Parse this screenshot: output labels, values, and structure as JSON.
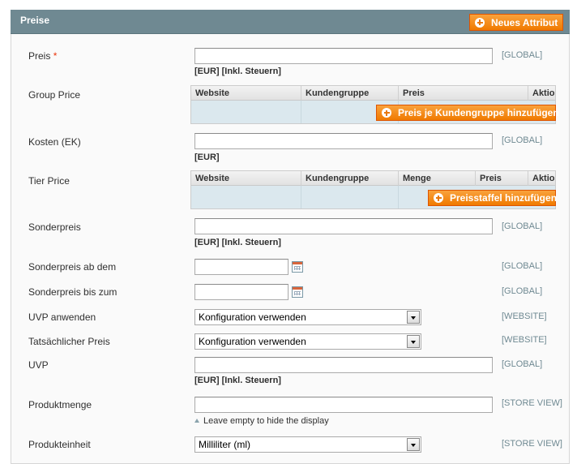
{
  "section": {
    "title": "Preise",
    "add_attribute": "Neues Attribut"
  },
  "fields": {
    "preis": {
      "label": "Preis",
      "required_mark": "*",
      "note": "[EUR] [Inkl. Steuern]",
      "scope": "[GLOBAL]",
      "value": ""
    },
    "group_price": {
      "label": "Group Price",
      "columns": [
        "Website",
        "Kundengruppe",
        "Preis",
        "Aktio"
      ],
      "add_button": "Preis je Kundengruppe hinzufügen"
    },
    "kosten": {
      "label": "Kosten (EK)",
      "note": "[EUR]",
      "scope": "[GLOBAL]",
      "value": ""
    },
    "tier_price": {
      "label": "Tier Price",
      "columns": [
        "Website",
        "Kundengruppe",
        "Menge",
        "Preis",
        "Aktio"
      ],
      "add_button": "Preisstaffel hinzufügen"
    },
    "sonderpreis": {
      "label": "Sonderpreis",
      "note": "[EUR] [Inkl. Steuern]",
      "scope": "[GLOBAL]",
      "value": ""
    },
    "sonderpreis_ab": {
      "label": "Sonderpreis ab dem",
      "scope": "[GLOBAL]",
      "value": ""
    },
    "sonderpreis_bis": {
      "label": "Sonderpreis bis zum",
      "scope": "[GLOBAL]",
      "value": ""
    },
    "uvp_anwenden": {
      "label": "UVP anwenden",
      "selected": "Konfiguration verwenden",
      "scope": "[WEBSITE]"
    },
    "tatsaechlicher_preis": {
      "label": "Tatsächlicher Preis",
      "selected": "Konfiguration verwenden",
      "scope": "[WEBSITE]"
    },
    "uvp": {
      "label": "UVP",
      "note": "[EUR] [Inkl. Steuern]",
      "scope": "[GLOBAL]",
      "value": ""
    },
    "produktmenge": {
      "label": "Produktmenge",
      "hint": "Leave empty to hide the display",
      "scope": "[STORE VIEW]",
      "value": ""
    },
    "produkteinheit": {
      "label": "Produkteinheit",
      "selected": "Milliliter (ml)",
      "scope": "[STORE VIEW]"
    }
  },
  "colors": {
    "header_bg": "#6f8992",
    "button_orange": "#f18200",
    "scope_text": "#6f8992",
    "grid_body": "#dbe8ee"
  }
}
